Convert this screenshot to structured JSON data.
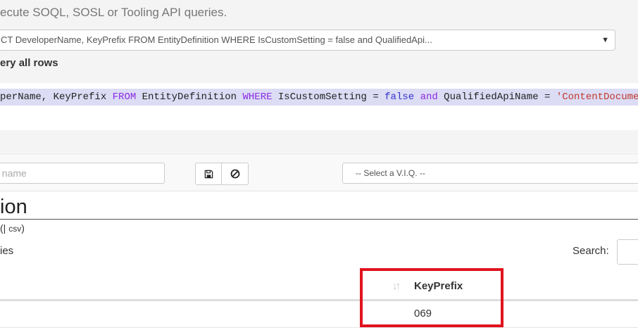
{
  "header": {
    "subtitle": "ecute SOQL, SOSL or Tooling API queries.",
    "query_selected": "CT DeveloperName, KeyPrefix FROM EntityDefinition WHERE IsCustomSetting = false and QualifiedApi...",
    "query_all_rows_label": "ery all rows"
  },
  "editor": {
    "tokens": [
      {
        "text": "perName, KeyPrefix ",
        "kind": "plain"
      },
      {
        "text": "FROM",
        "kind": "kw"
      },
      {
        "text": " EntityDefinition ",
        "kind": "plain"
      },
      {
        "text": "WHERE",
        "kind": "kw"
      },
      {
        "text": " IsCustomSetting = ",
        "kind": "plain"
      },
      {
        "text": "false",
        "kind": "kwb"
      },
      {
        "text": " ",
        "kind": "plain"
      },
      {
        "text": "and",
        "kind": "kw"
      },
      {
        "text": " QualifiedApiName = ",
        "kind": "plain"
      },
      {
        "text": "'ContentDocument'",
        "kind": "str"
      }
    ]
  },
  "toolbar": {
    "name_placeholder": ". name",
    "save_icon": "floppy-disk-icon",
    "clear_icon": "ban-icon",
    "viq_select": "-- Select a V.I.Q. --"
  },
  "results": {
    "title": "ion",
    "export_open": "(",
    "export_sep": "|",
    "export_csv": "csv",
    "export_close": ")",
    "entries_label": "ies",
    "search_label": "Search:",
    "columns": [
      {
        "label": "KeyPrefix"
      }
    ],
    "rows": [
      {
        "KeyPrefix": "069"
      }
    ]
  },
  "colors": {
    "highlight": "#e0141e",
    "editor_highlight": "#dcdcf5"
  }
}
